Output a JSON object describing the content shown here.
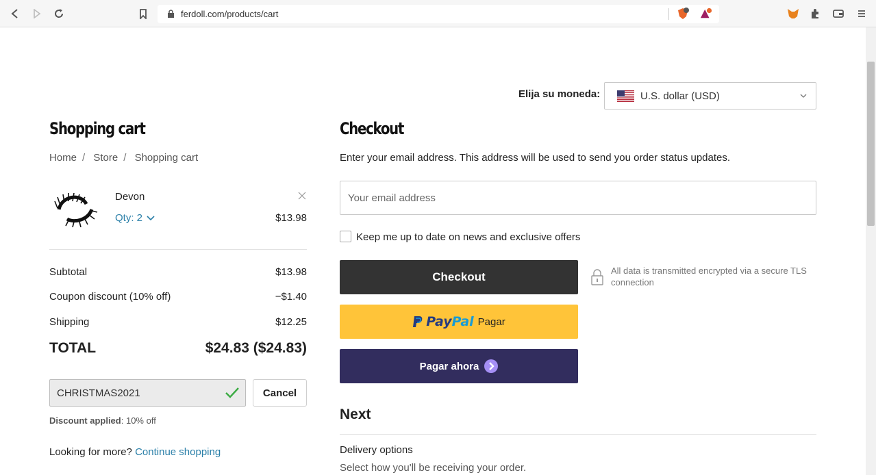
{
  "browser": {
    "url": "ferdoll.com/products/cart"
  },
  "currency": {
    "label": "Elija su moneda:",
    "selected": "U.S. dollar (USD)",
    "flag": "us-flag-icon"
  },
  "cart": {
    "title": "Shopping cart",
    "breadcrumb": [
      "Home",
      "Store",
      "Shopping cart"
    ],
    "item": {
      "name": "Devon",
      "qty_label": "Qty: 2",
      "price": "$13.98"
    },
    "summary": {
      "subtotal_label": "Subtotal",
      "subtotal_value": "$13.98",
      "coupon_label": "Coupon discount (10% off)",
      "coupon_value": "−$1.40",
      "shipping_label": "Shipping",
      "shipping_value": "$12.25",
      "total_label": "TOTAL",
      "total_value": "$24.83 ($24.83)"
    },
    "coupon": {
      "code": "CHRISTMAS2021",
      "cancel_label": "Cancel",
      "note_prefix": "Discount applied",
      "note_suffix": ": 10% off"
    },
    "more": {
      "prefix": "Looking for more?",
      "link": "Continue shopping"
    }
  },
  "checkout": {
    "title": "Checkout",
    "description": "Enter your email address. This address will be used to send you order status updates.",
    "email_placeholder": "Your email address",
    "newsletter_label": "Keep me up to date on news and exclusive offers",
    "checkout_button": "Checkout",
    "paypal_pay": "Pay",
    "paypal_pal": "Pal",
    "paypal_text": "Pagar",
    "pay_now_button": "Pagar ahora",
    "secure_note": "All data is transmitted encrypted via a secure TLS connection",
    "next_title": "Next",
    "delivery_title": "Delivery options",
    "delivery_desc": "Select how you'll be receiving your order."
  },
  "colors": {
    "accent_link": "#2a7fa8",
    "checkout_bg": "#333333",
    "paypal_bg": "#ffc439",
    "pay_now_bg": "#322d5e"
  }
}
